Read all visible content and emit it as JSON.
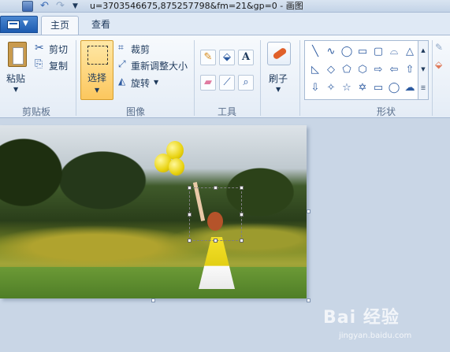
{
  "window": {
    "title": "u=3703546675,875257798&fm=21&gp=0 - 画图"
  },
  "tabs": {
    "home": "主页",
    "view": "查看"
  },
  "clipboard": {
    "paste": "粘贴",
    "cut": "剪切",
    "copy": "复制",
    "group": "剪贴板"
  },
  "image": {
    "select": "选择",
    "crop": "裁剪",
    "resize": "重新调整大小",
    "rotate": "旋转",
    "group": "图像"
  },
  "tools": {
    "group": "工具",
    "items": [
      "pencil-icon",
      "fill-icon",
      "text-icon",
      "eraser-icon",
      "color-picker-icon",
      "magnifier-icon"
    ],
    "text_glyph": "A"
  },
  "brushes": {
    "label": "刷子"
  },
  "shapes": {
    "group": "形状",
    "glyphs": [
      "╲",
      "∿",
      "◯",
      "▭",
      "▢",
      "⌓",
      "△",
      "◺",
      "◇",
      "⬠",
      "⬡",
      "⇨",
      "⇦",
      "⇧",
      "⇩",
      "✧",
      "☆",
      "✡",
      "▭",
      "◯",
      "☁"
    ]
  },
  "watermark": {
    "logo": "Bai 经验",
    "url": "jingyan.baidu.com"
  },
  "colors": {
    "accent": "#1d5bb0",
    "select_active": "#fcc75e"
  }
}
